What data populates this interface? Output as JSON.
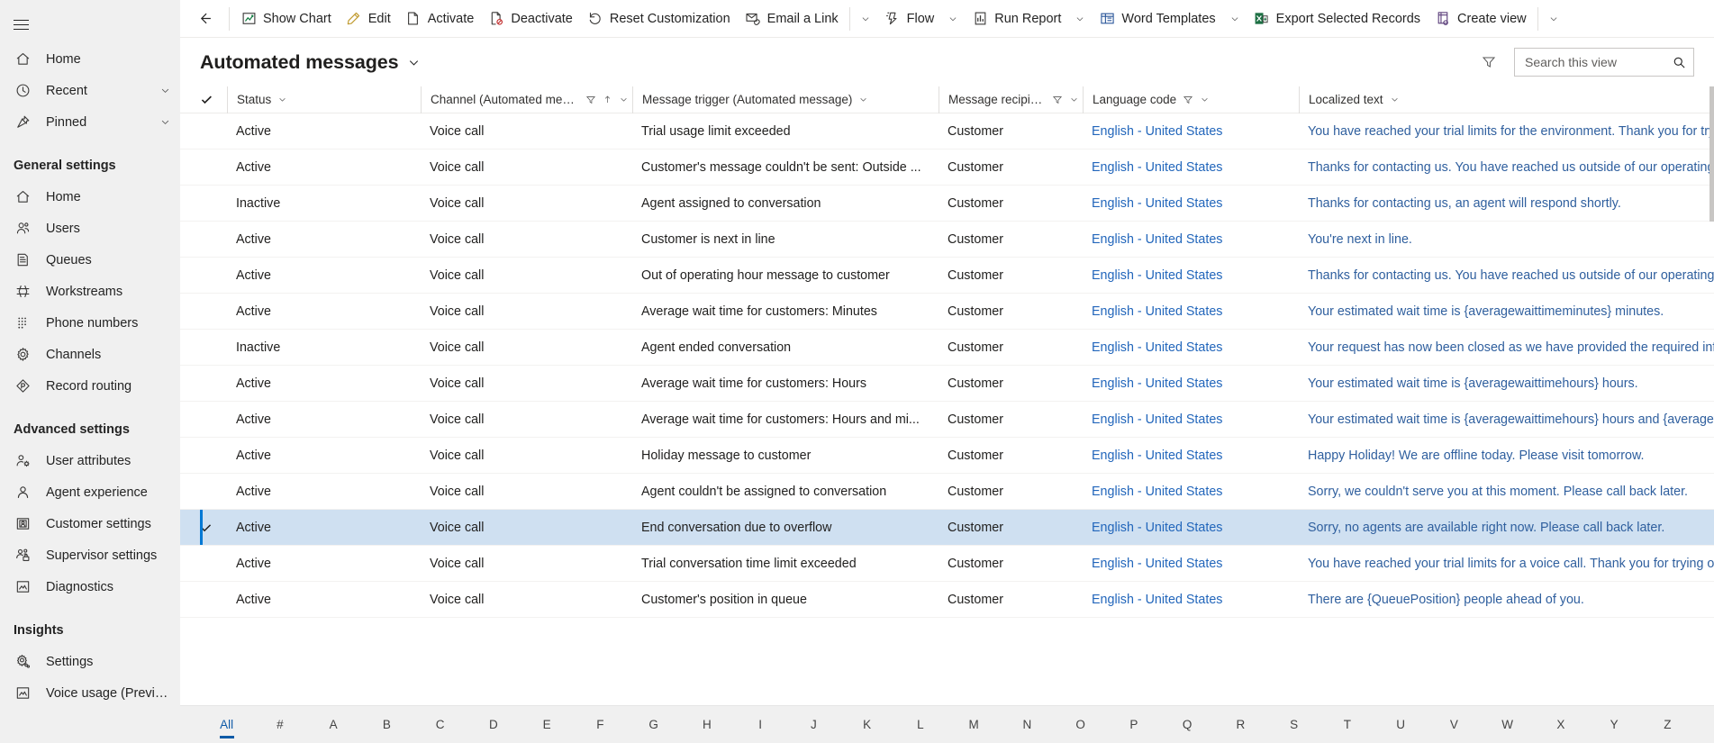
{
  "sidebar": {
    "menu_icon": "hamburger-icon",
    "top_items": [
      {
        "label": "Home",
        "icon": "home-icon",
        "chevron": false
      },
      {
        "label": "Recent",
        "icon": "clock-icon",
        "chevron": true
      },
      {
        "label": "Pinned",
        "icon": "pin-icon",
        "chevron": true
      }
    ],
    "groups": [
      {
        "title": "General settings",
        "items": [
          {
            "label": "Home",
            "icon": "home-icon"
          },
          {
            "label": "Users",
            "icon": "users-icon"
          },
          {
            "label": "Queues",
            "icon": "queues-icon"
          },
          {
            "label": "Workstreams",
            "icon": "workstreams-icon"
          },
          {
            "label": "Phone numbers",
            "icon": "phone-numbers-icon"
          },
          {
            "label": "Channels",
            "icon": "gear-icon"
          },
          {
            "label": "Record routing",
            "icon": "record-routing-icon"
          }
        ]
      },
      {
        "title": "Advanced settings",
        "items": [
          {
            "label": "User attributes",
            "icon": "user-attributes-icon"
          },
          {
            "label": "Agent experience",
            "icon": "agent-icon"
          },
          {
            "label": "Customer settings",
            "icon": "customer-settings-icon"
          },
          {
            "label": "Supervisor settings",
            "icon": "supervisor-icon"
          },
          {
            "label": "Diagnostics",
            "icon": "diagnostics-icon"
          }
        ]
      },
      {
        "title": "Insights",
        "items": [
          {
            "label": "Settings",
            "icon": "insights-gear-icon"
          },
          {
            "label": "Voice usage (Preview)",
            "icon": "voice-usage-icon"
          }
        ]
      }
    ]
  },
  "commandbar": {
    "back_icon": "back-arrow-icon",
    "buttons": [
      {
        "label": "Show Chart",
        "icon": "chart-icon",
        "caret": false
      },
      {
        "label": "Edit",
        "icon": "pencil-icon",
        "caret": false
      },
      {
        "label": "Activate",
        "icon": "activate-icon",
        "caret": false
      },
      {
        "label": "Deactivate",
        "icon": "deactivate-icon",
        "caret": false
      },
      {
        "label": "Reset Customization",
        "icon": "reset-icon",
        "caret": false
      },
      {
        "label": "Email a Link",
        "icon": "email-link-icon",
        "caret": false,
        "separator_after": true,
        "caret_after_separator": true
      },
      {
        "label": "Flow",
        "icon": "flow-icon",
        "caret": true
      },
      {
        "label": "Run Report",
        "icon": "run-report-icon",
        "caret": true
      },
      {
        "label": "Word Templates",
        "icon": "word-templates-icon",
        "caret": true
      },
      {
        "label": "Export Selected Records",
        "icon": "excel-icon",
        "caret": false
      },
      {
        "label": "Create view",
        "icon": "create-view-icon",
        "caret": false,
        "separator_after": true,
        "caret_after_separator": true
      }
    ]
  },
  "view": {
    "title": "Automated messages",
    "title_caret_icon": "chevron-down-icon",
    "filter_icon": "filter-icon",
    "search": {
      "placeholder": "Search this view",
      "value": "",
      "icon": "search-icon"
    }
  },
  "grid": {
    "select_all_icon": "checkmark-icon",
    "columns": [
      {
        "key": "status",
        "label": "Status",
        "filter": false,
        "sort": null,
        "caret": true,
        "class": "c-status"
      },
      {
        "key": "channel",
        "label": "Channel (Automated message)",
        "filter": true,
        "sort": "asc",
        "caret": true,
        "class": "c-channel"
      },
      {
        "key": "trigger",
        "label": "Message trigger (Automated message)",
        "filter": false,
        "sort": null,
        "caret": true,
        "class": "c-trigger"
      },
      {
        "key": "recipient",
        "label": "Message recipient (...",
        "filter": true,
        "sort": null,
        "caret": true,
        "class": "c-recip"
      },
      {
        "key": "language",
        "label": "Language code",
        "filter": true,
        "sort": null,
        "caret": true,
        "class": "c-lang"
      },
      {
        "key": "localized",
        "label": "Localized text",
        "filter": false,
        "sort": null,
        "caret": true,
        "class": "c-loc"
      }
    ],
    "rows": [
      {
        "selected": false,
        "status": "Active",
        "channel": "Voice call",
        "trigger": "Trial usage limit exceeded",
        "recipient": "Customer",
        "language": "English - United States",
        "localized": "You have reached your trial limits for the environment. Thank you for trying out the service."
      },
      {
        "selected": false,
        "status": "Active",
        "channel": "Voice call",
        "trigger": "Customer's message couldn't be sent: Outside ...",
        "recipient": "Customer",
        "language": "English - United States",
        "localized": "Thanks for contacting us. You have reached us outside of our operating hours."
      },
      {
        "selected": false,
        "status": "Inactive",
        "channel": "Voice call",
        "trigger": "Agent assigned to conversation",
        "recipient": "Customer",
        "language": "English - United States",
        "localized": "Thanks for contacting us, an agent will respond shortly."
      },
      {
        "selected": false,
        "status": "Active",
        "channel": "Voice call",
        "trigger": "Customer is next in line",
        "recipient": "Customer",
        "language": "English - United States",
        "localized": "You're next in line."
      },
      {
        "selected": false,
        "status": "Active",
        "channel": "Voice call",
        "trigger": "Out of operating hour message to customer",
        "recipient": "Customer",
        "language": "English - United States",
        "localized": "Thanks for contacting us. You have reached us outside of our operating hours."
      },
      {
        "selected": false,
        "status": "Active",
        "channel": "Voice call",
        "trigger": "Average wait time for customers: Minutes",
        "recipient": "Customer",
        "language": "English - United States",
        "localized": "Your estimated wait time is {averagewaittimeminutes} minutes."
      },
      {
        "selected": false,
        "status": "Inactive",
        "channel": "Voice call",
        "trigger": "Agent ended conversation",
        "recipient": "Customer",
        "language": "English - United States",
        "localized": "Your request has now been closed as we have provided the required information."
      },
      {
        "selected": false,
        "status": "Active",
        "channel": "Voice call",
        "trigger": "Average wait time for customers: Hours",
        "recipient": "Customer",
        "language": "English - United States",
        "localized": "Your estimated wait time is {averagewaittimehours} hours."
      },
      {
        "selected": false,
        "status": "Active",
        "channel": "Voice call",
        "trigger": "Average wait time for customers: Hours and mi...",
        "recipient": "Customer",
        "language": "English - United States",
        "localized": "Your estimated wait time is {averagewaittimehours} hours and {averagewaittimeminutes} minutes."
      },
      {
        "selected": false,
        "status": "Active",
        "channel": "Voice call",
        "trigger": "Holiday message to customer",
        "recipient": "Customer",
        "language": "English - United States",
        "localized": "Happy Holiday! We are offline today. Please visit tomorrow."
      },
      {
        "selected": false,
        "status": "Active",
        "channel": "Voice call",
        "trigger": "Agent couldn't be assigned to conversation",
        "recipient": "Customer",
        "language": "English - United States",
        "localized": "Sorry, we couldn't serve you at this moment. Please call back later."
      },
      {
        "selected": true,
        "status": "Active",
        "channel": "Voice call",
        "trigger": "End conversation due to overflow",
        "recipient": "Customer",
        "language": "English - United States",
        "localized": "Sorry, no agents are available right now. Please call back later."
      },
      {
        "selected": false,
        "status": "Active",
        "channel": "Voice call",
        "trigger": "Trial conversation time limit exceeded",
        "recipient": "Customer",
        "language": "English - United States",
        "localized": "You have reached your trial limits for a voice call. Thank you for trying out the service."
      },
      {
        "selected": false,
        "status": "Active",
        "channel": "Voice call",
        "trigger": "Customer's position in queue",
        "recipient": "Customer",
        "language": "English - United States",
        "localized": "There are {QueuePosition} people ahead of you."
      }
    ]
  },
  "alphabar": {
    "active": "All",
    "items": [
      "All",
      "#",
      "A",
      "B",
      "C",
      "D",
      "E",
      "F",
      "G",
      "H",
      "I",
      "J",
      "K",
      "L",
      "M",
      "N",
      "O",
      "P",
      "Q",
      "R",
      "S",
      "T",
      "U",
      "V",
      "W",
      "X",
      "Y",
      "Z"
    ]
  },
  "colors": {
    "accent": "#0f5ba7",
    "link": "#2266bb",
    "selected_row": "#cfe0f1",
    "sidebar_bg": "#f0f0f0",
    "excel_green": "#1d7044"
  }
}
